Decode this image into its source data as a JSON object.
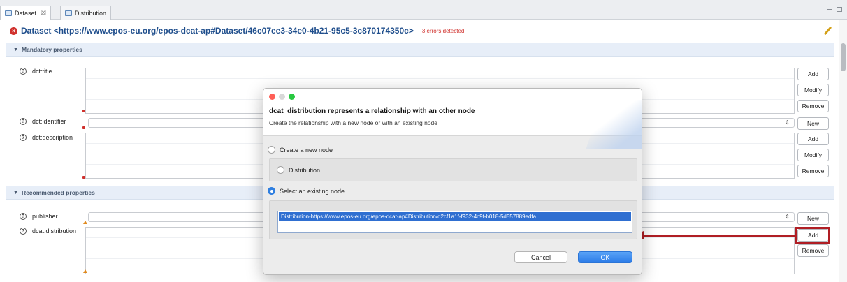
{
  "tabs": [
    {
      "label": "Dataset",
      "active": true
    },
    {
      "label": "Distribution",
      "active": false
    }
  ],
  "tab_close_glyph": "☒",
  "header": {
    "title": "Dataset <https://www.epos-eu.org/epos-dcat-ap#Dataset/46c07ee3-34e0-4b21-95c5-3c870174350c>",
    "errors": "3 errors detected"
  },
  "sections": {
    "mandatory": "Mandatory properties",
    "recommended": "Recommended properties"
  },
  "props": {
    "title": "dct:title",
    "identifier": "dct:identifier",
    "description": "dct:description",
    "publisher": "publisher",
    "distribution": "dcat:distribution"
  },
  "buttons": {
    "add": "Add",
    "modify": "Modify",
    "remove": "Remove",
    "new": "New"
  },
  "dialog": {
    "title": "dcat_distribution represents a relationship with an other node",
    "subtitle": "Create the relationship with a new node or with an existing node",
    "option_new": "Create a new node",
    "option_new_type": "Distribution",
    "option_existing": "Select an existing node",
    "existing_nodes": [
      "Distribution-https://www.epos-eu.org/epos-dcat-ap#Distribution/d2cf1a1f-f932-4c9f-b018-5d557889edfa"
    ],
    "cancel": "Cancel",
    "ok": "OK"
  },
  "colors": {
    "accent": "#2f7fe0",
    "error": "#d0312d",
    "highlight": "#b01e24",
    "title_blue": "#1f4e8c"
  }
}
